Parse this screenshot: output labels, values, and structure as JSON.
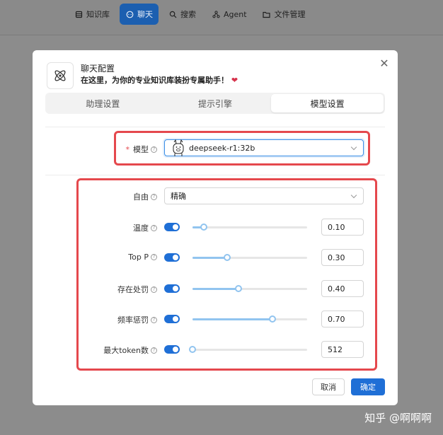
{
  "nav": {
    "items": [
      {
        "label": "知识库",
        "icon": "database-icon"
      },
      {
        "label": "聊天",
        "icon": "chat-icon",
        "active": true
      },
      {
        "label": "搜索",
        "icon": "search-icon"
      },
      {
        "label": "Agent",
        "icon": "agent-icon"
      },
      {
        "label": "文件管理",
        "icon": "folder-icon"
      }
    ]
  },
  "modal": {
    "title": "聊天配置",
    "subtitle": "在这里，为你的专业知识库装扮专属助手！",
    "close_icon": "close-icon"
  },
  "tabs": [
    {
      "label": "助理设置"
    },
    {
      "label": "提示引擎"
    },
    {
      "label": "模型设置",
      "active": true
    }
  ],
  "model": {
    "required_mark": "*",
    "label": "模型",
    "value": "deepseek-r1:32b",
    "icon": "llama-icon"
  },
  "params": {
    "freedom": {
      "label": "自由",
      "value": "精确"
    },
    "rows": [
      {
        "label": "温度",
        "enabled": true,
        "value": "0.10",
        "fraction": 0.1
      },
      {
        "label": "Top P",
        "enabled": true,
        "value": "0.30",
        "fraction": 0.3
      },
      {
        "label": "存在处罚",
        "enabled": true,
        "value": "0.40",
        "fraction": 0.4
      },
      {
        "label": "频率惩罚",
        "enabled": true,
        "value": "0.70",
        "fraction": 0.7
      },
      {
        "label": "最大token数",
        "enabled": true,
        "value": "512",
        "fraction": 0.0
      }
    ]
  },
  "footer": {
    "cancel_label": "取消",
    "ok_label": "确定"
  },
  "watermark": "知乎 @啊啊啊",
  "colors": {
    "accent": "#1f6fd6",
    "highlight": "#e5484d",
    "slider": "#91c4ef"
  }
}
